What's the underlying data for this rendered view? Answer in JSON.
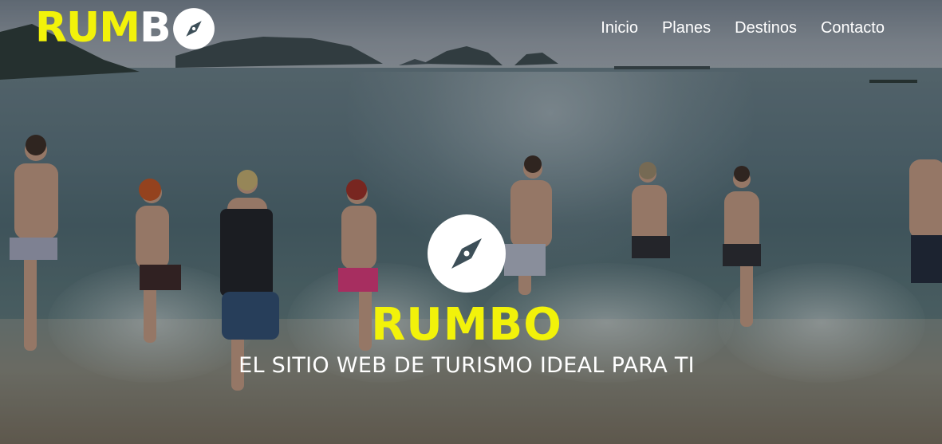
{
  "header": {
    "logo_part_a": "RUM",
    "logo_part_b": "B",
    "logo_icon": "compass-icon"
  },
  "nav": {
    "items": [
      {
        "label": "Inicio"
      },
      {
        "label": "Planes"
      },
      {
        "label": "Destinos"
      },
      {
        "label": "Contacto"
      }
    ]
  },
  "hero": {
    "icon": "compass-icon",
    "title": "RUMBO",
    "subtitle": "EL SITIO WEB DE TURISMO IDEAL PARA TI"
  },
  "colors": {
    "accent_yellow": "#f2f20a",
    "text_white": "#ffffff"
  }
}
